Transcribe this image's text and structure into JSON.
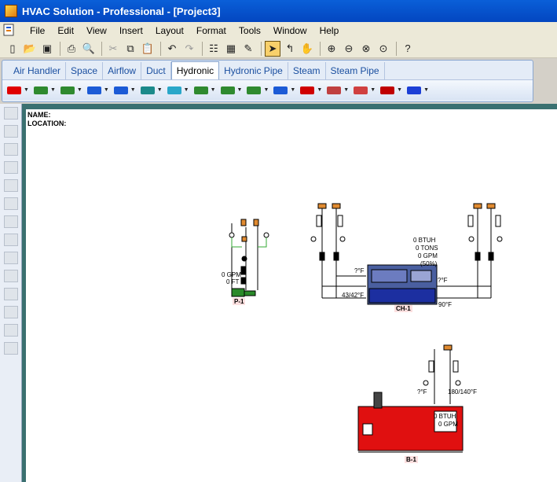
{
  "window": {
    "title": "HVAC Solution - Professional - [Project3]"
  },
  "menu": {
    "items": [
      "File",
      "Edit",
      "View",
      "Insert",
      "Layout",
      "Format",
      "Tools",
      "Window",
      "Help"
    ]
  },
  "toolbar": {
    "icons": [
      "new-icon",
      "open-icon",
      "save-icon",
      "print-icon",
      "print-preview-icon",
      "cut-icon",
      "copy-icon",
      "paste-icon",
      "undo-icon",
      "redo-icon",
      "properties-icon",
      "calculator-icon",
      "paint-icon",
      "select-arrow-icon",
      "connect-icon",
      "pan-hand-icon",
      "zoom-in-icon",
      "zoom-out-icon",
      "zoom-fit-icon",
      "zoom-window-icon",
      "context-help-icon"
    ],
    "active": "select-arrow-icon"
  },
  "tabs": {
    "items": [
      "Air Handler",
      "Space",
      "Airflow",
      "Duct",
      "Hydronic",
      "Hydronic Pipe",
      "Steam",
      "Steam Pipe"
    ],
    "active": "Hydronic"
  },
  "ribbon_tools": {
    "colors": [
      "#e00000",
      "#2f8a2f",
      "#2f8a2f",
      "#1c5bd6",
      "#1c5bd6",
      "#1c8a8a",
      "#2aa7c9",
      "#2f8a2f",
      "#2f8a2f",
      "#2f8a2f",
      "#1c5bd6",
      "#d00000",
      "#c04040",
      "#d04040",
      "#c00000",
      "#1c3fd6"
    ]
  },
  "drawing": {
    "name_label": "NAME:",
    "location_label": "LOCATION:",
    "pump": {
      "tag": "P-1",
      "flow": "0 GPM",
      "head": "0 FT"
    },
    "chiller": {
      "tag": "CH-1",
      "capacity_btuh": "0 BTUH",
      "tons": "0 TONS",
      "gpm": "0 GPM",
      "percent": "(50%)",
      "temp_in_left": "?°F",
      "temp_in_right": "?°F",
      "temp_chw": "43/42°F",
      "temp_cw": "90°F"
    },
    "boiler": {
      "tag": "B-1",
      "capacity_btuh": "0 BTUH",
      "gpm": "0 GPM",
      "temp_left": "?°F",
      "temp_right": "180/140°F"
    }
  }
}
